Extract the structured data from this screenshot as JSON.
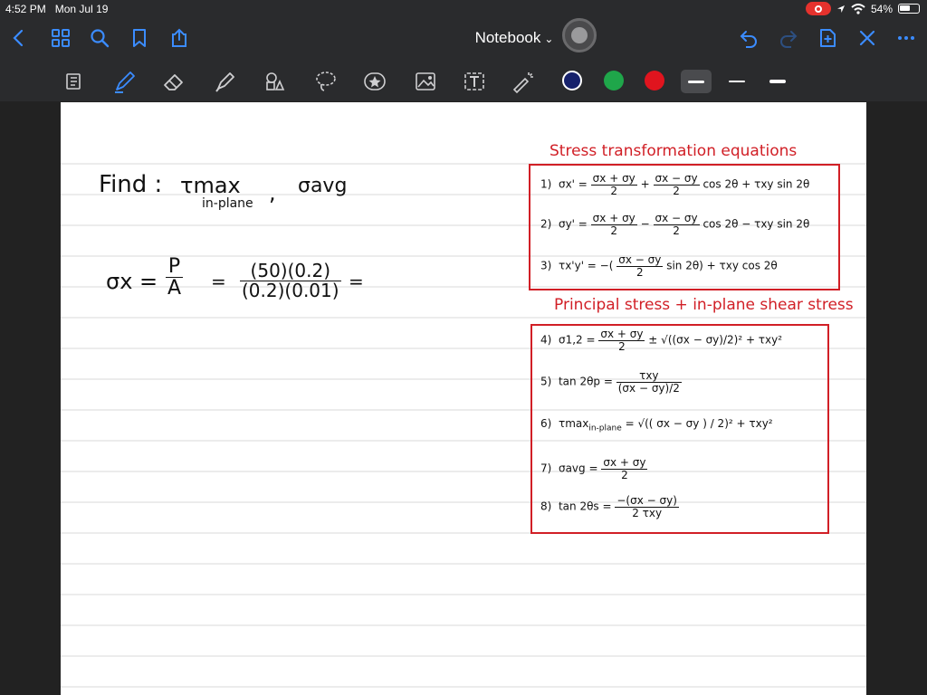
{
  "status": {
    "time": "4:52 PM",
    "date": "Mon Jul 19",
    "battery": "54%"
  },
  "nav": {
    "title": "Notebook",
    "title_caret": "⌄"
  },
  "colors": {
    "accent": "#3b8cff",
    "ink_navy": "#16216b",
    "ink_green": "#1fa64a",
    "ink_red": "#e0141e"
  },
  "note": {
    "find_label": "Find :",
    "tau_max": "τmax",
    "in_plane": "in-plane",
    "comma": ",",
    "sigma_avg": "σavg",
    "sx_lhs": "σx =",
    "p_num": "P",
    "a_den": "A",
    "eq_sign": "=",
    "num_expr": "(50)(0.2)",
    "den_expr": "(0.2)(0.01)",
    "trail_eq": "="
  },
  "reference": {
    "heading1": "Stress transformation equations",
    "eq1_label": "1)",
    "eq1_lhs": "σx' =",
    "eq1_a_num": "σx + σy",
    "eq1_a_den": "2",
    "eq1_plus": "+",
    "eq1_b_num": "σx − σy",
    "eq1_b_den": "2",
    "eq1_tail": "cos 2θ + τxy sin 2θ",
    "eq2_label": "2)",
    "eq2_lhs": "σy' =",
    "eq2_a_num": "σx + σy",
    "eq2_a_den": "2",
    "eq2_minus": "−",
    "eq2_b_num": "σx − σy",
    "eq2_b_den": "2",
    "eq2_tail": "cos 2θ − τxy sin 2θ",
    "eq3_label": "3)",
    "eq3_lhs": "τx'y' = −(",
    "eq3_num": "σx − σy",
    "eq3_den": "2",
    "eq3_tail": "sin 2θ) + τxy cos 2θ",
    "heading2": "Principal stress + in-plane shear stress",
    "eq4_label": "4)",
    "eq4_lhs": "σ1,2 =",
    "eq4_num": "σx + σy",
    "eq4_den": "2",
    "eq4_tail": "± √((σx − σy)/2)² + τxy²",
    "eq5_label": "5)",
    "eq5_lhs": "tan 2θp =",
    "eq5_num": "τxy",
    "eq5_den": "(σx − σy)/2",
    "eq6_label": "6)",
    "eq6_lhs": "τmax",
    "eq6_sub": "in-plane",
    "eq6_tail": "= √(( σx − σy ) / 2)² + τxy²",
    "eq7_label": "7)",
    "eq7_lhs": "σavg =",
    "eq7_num": "σx + σy",
    "eq7_den": "2",
    "eq8_label": "8)",
    "eq8_lhs": "tan 2θs =",
    "eq8_num": "−(σx − σy)",
    "eq8_den": "2 τxy"
  }
}
